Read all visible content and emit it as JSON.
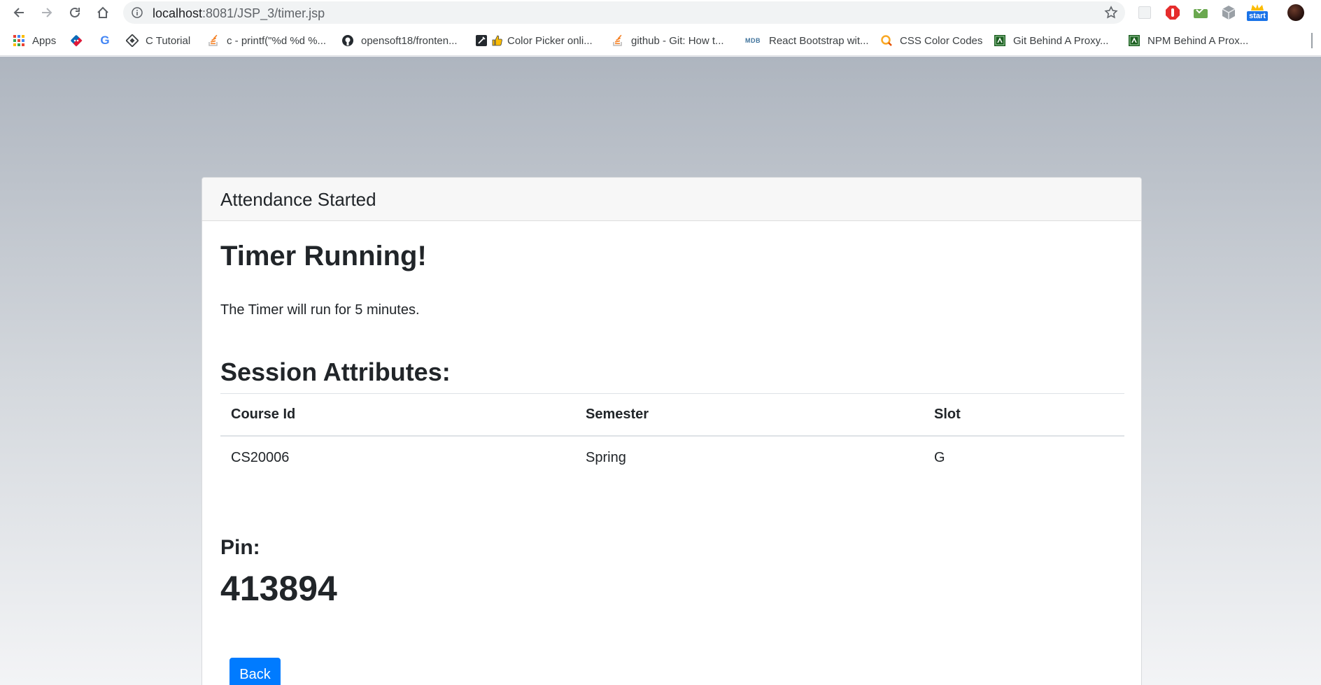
{
  "browser": {
    "url_host": "localhost",
    "url_rest": ":8081/JSP_3/timer.jsp",
    "bookmarks": [
      {
        "label": "Apps",
        "icon": "apps-grid-icon"
      },
      {
        "label": "",
        "icon": "dominos-icon"
      },
      {
        "label": "",
        "icon": "google-icon"
      },
      {
        "label": "C Tutorial",
        "icon": "diamond-icon"
      },
      {
        "label": "c - printf(\"%d %d %...",
        "icon": "stackoverflow-icon"
      },
      {
        "label": "opensoft18/fronten...",
        "icon": "github-icon"
      },
      {
        "label": "Color Picker onli...",
        "icon": "color-picker-icon"
      },
      {
        "label": "github - Git: How t...",
        "icon": "stackoverflow-icon"
      },
      {
        "label": "React Bootstrap wit...",
        "icon": "mdb-icon"
      },
      {
        "label": "CSS Color Codes",
        "icon": "search-color-icon"
      },
      {
        "label": "Git Behind A Proxy...",
        "icon": "proxy-icon"
      },
      {
        "label": "NPM Behind A Prox...",
        "icon": "proxy-icon"
      }
    ],
    "extension_badge": "start"
  },
  "card": {
    "header": "Attendance Started",
    "title": "Timer Running!",
    "description": "The Timer will run for 5 minutes.",
    "session_heading": "Session Attributes:",
    "table": {
      "columns": [
        "Course Id",
        "Semester",
        "Slot"
      ],
      "rows": [
        [
          "CS20006",
          "Spring",
          "G"
        ]
      ]
    },
    "pin_label": "Pin:",
    "pin_value": "413894",
    "back_label": "Back"
  },
  "colors": {
    "primary": "#007bff",
    "text": "#212529",
    "card_header_bg": "#f7f7f7"
  }
}
